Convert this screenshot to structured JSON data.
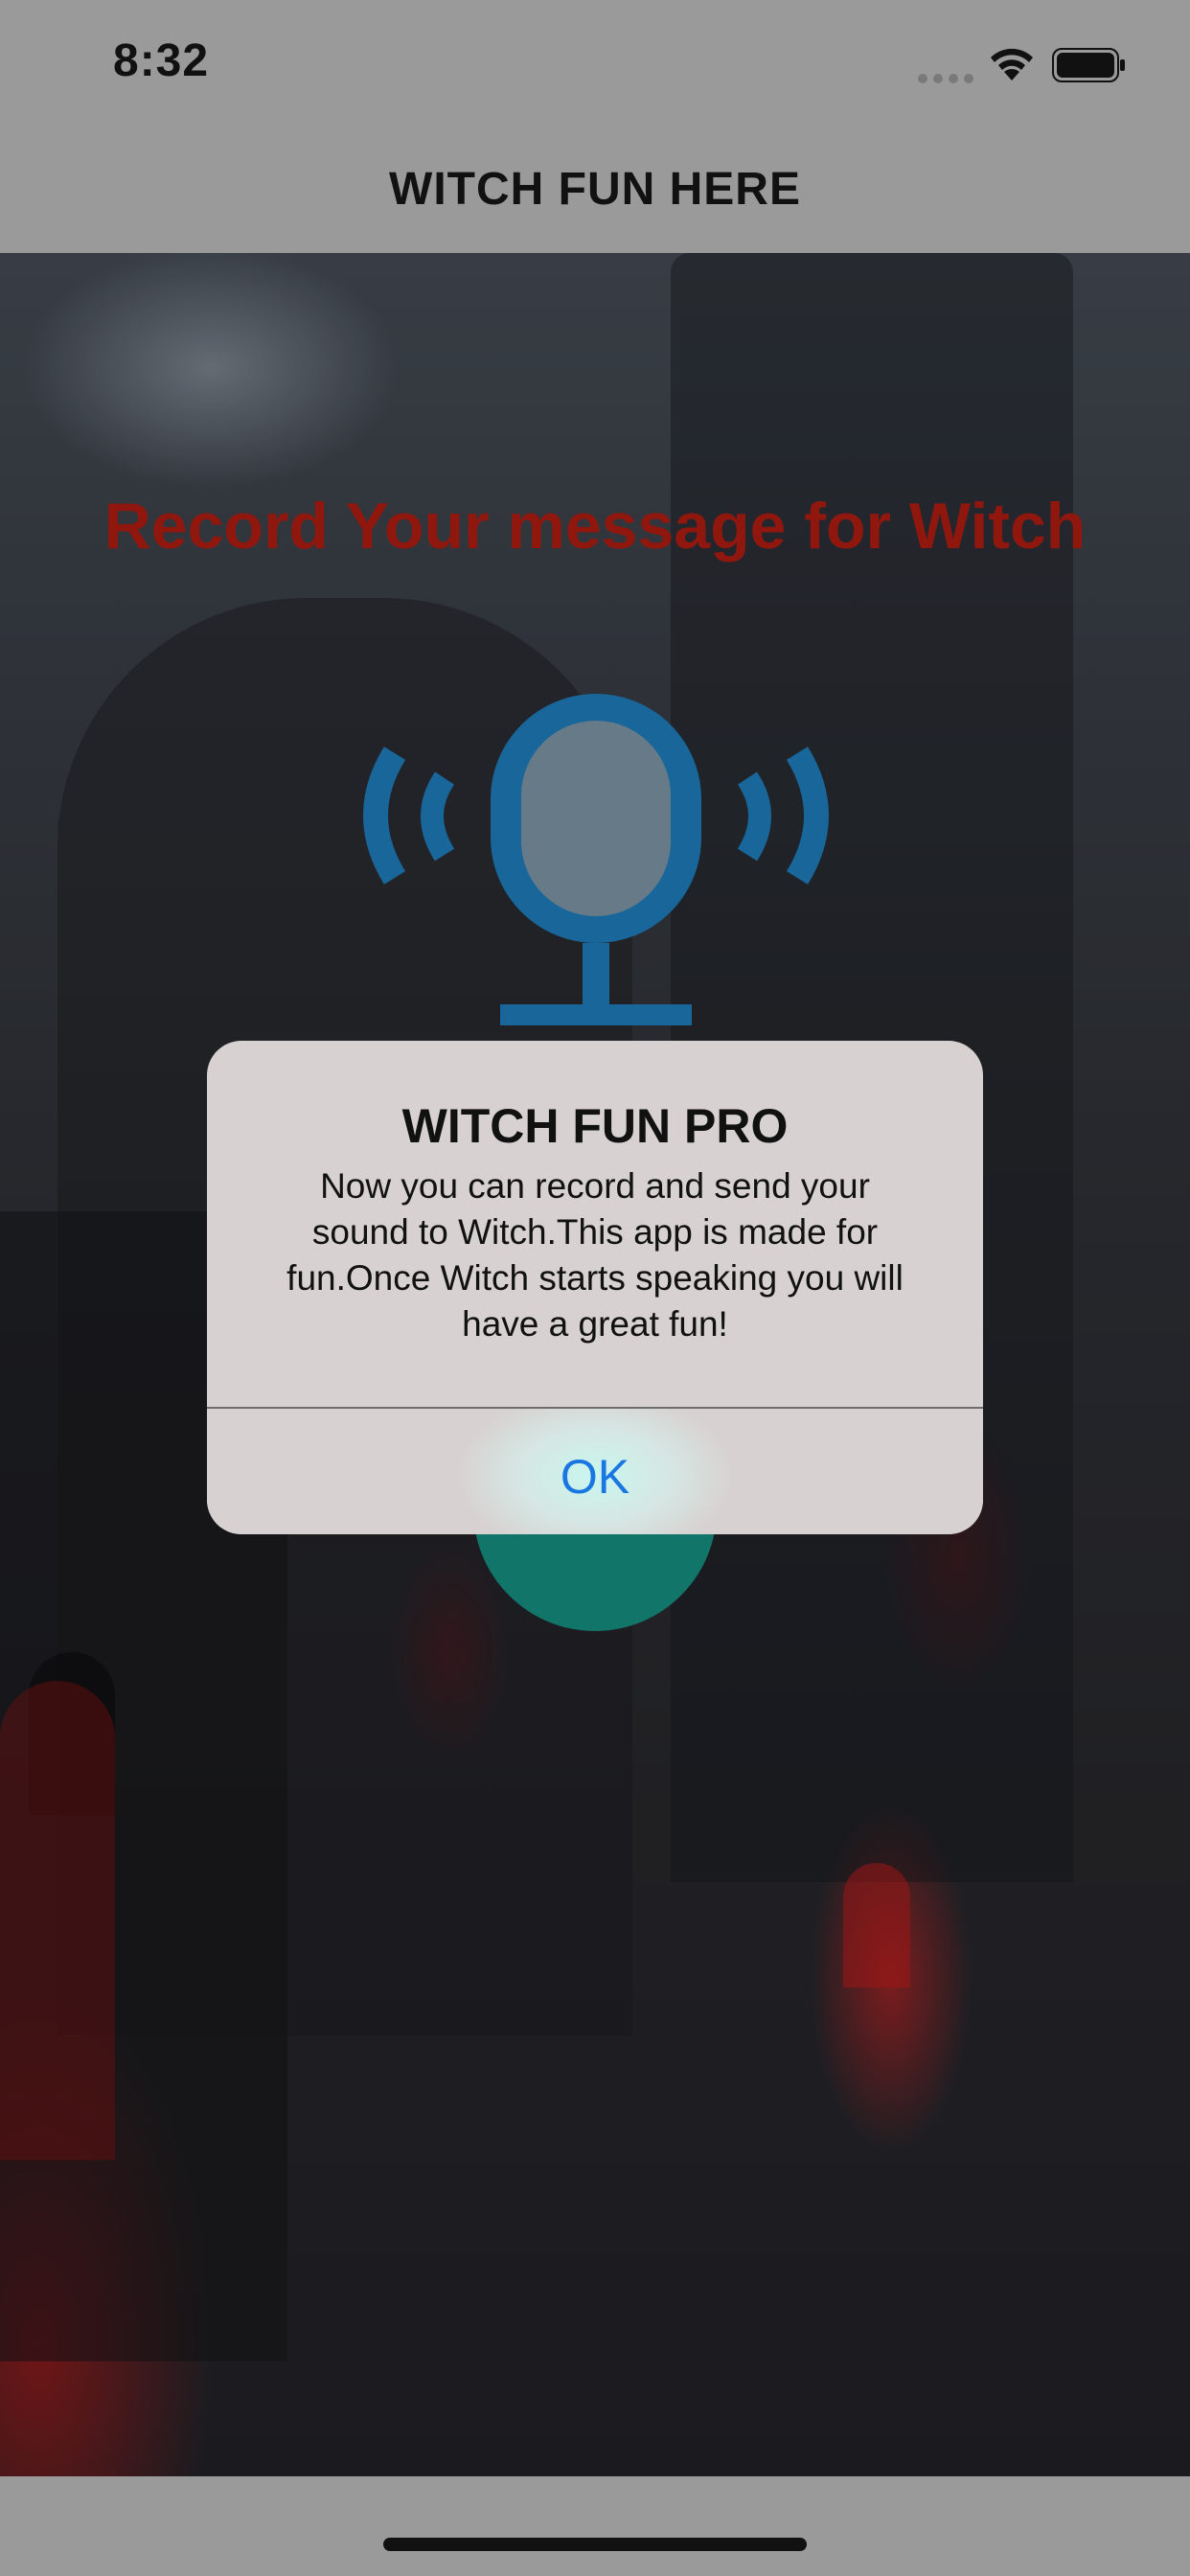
{
  "status_bar": {
    "time": "8:32"
  },
  "nav": {
    "title": "WITCH FUN HERE"
  },
  "main": {
    "heading": "Record Your message for Witch",
    "heading_color": "#9d1a10",
    "mic_color": "#1c6fa8",
    "record_button_color": "#137f74"
  },
  "alert": {
    "title": "WITCH FUN PRO",
    "message": "Now you can record and send your sound to Witch.This app is made for fun.Once Witch starts speaking you will have a great fun!",
    "ok_label": "OK",
    "ok_color": "#1a76e0"
  }
}
